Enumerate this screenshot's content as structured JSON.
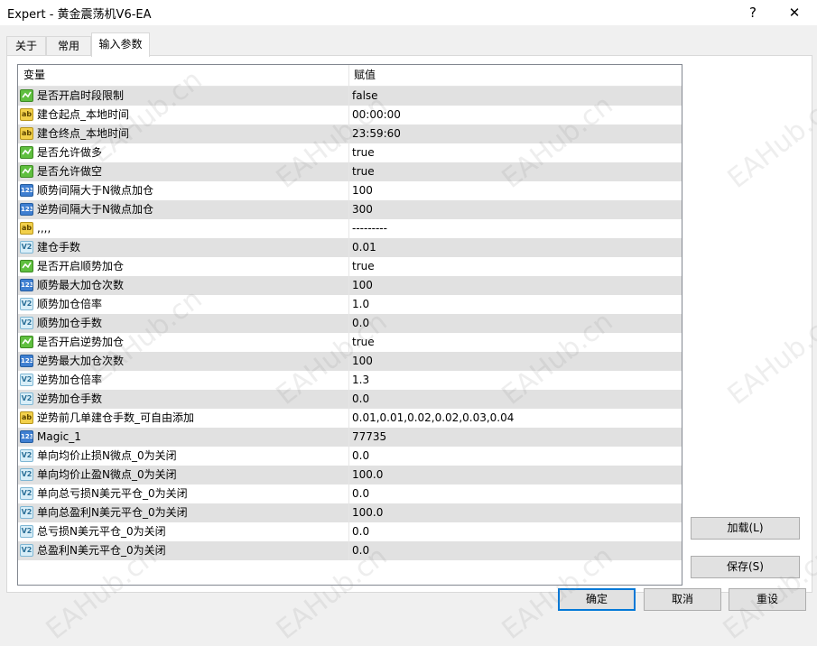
{
  "window": {
    "title": "Expert - 黄金震荡机V6-EA",
    "help_label": "?",
    "close_label": "✕"
  },
  "tabs": [
    {
      "label": "关于"
    },
    {
      "label": "常用"
    },
    {
      "label": "输入参数"
    }
  ],
  "grid": {
    "columns": {
      "variable": "变量",
      "value": "赋值"
    },
    "rows": [
      {
        "icon": "bool",
        "name": "是否开启时段限制",
        "value": "false"
      },
      {
        "icon": "str",
        "name": "建仓起点_本地时间",
        "value": "00:00:00"
      },
      {
        "icon": "str",
        "name": "建仓终点_本地时间",
        "value": "23:59:60"
      },
      {
        "icon": "bool",
        "name": "是否允许做多",
        "value": "true"
      },
      {
        "icon": "bool",
        "name": "是否允许做空",
        "value": "true"
      },
      {
        "icon": "int",
        "name": "顺势间隔大于N微点加仓",
        "value": "100"
      },
      {
        "icon": "int",
        "name": "逆势间隔大于N微点加仓",
        "value": "300"
      },
      {
        "icon": "str",
        "name": ",,,,",
        "value": "---------"
      },
      {
        "icon": "dbl",
        "name": "建仓手数",
        "value": "0.01"
      },
      {
        "icon": "bool",
        "name": "是否开启顺势加仓",
        "value": "true"
      },
      {
        "icon": "int",
        "name": "顺势最大加仓次数",
        "value": "100"
      },
      {
        "icon": "dbl",
        "name": "顺势加仓倍率",
        "value": "1.0"
      },
      {
        "icon": "dbl",
        "name": "顺势加仓手数",
        "value": "0.0"
      },
      {
        "icon": "bool",
        "name": "是否开启逆势加仓",
        "value": "true"
      },
      {
        "icon": "int",
        "name": "逆势最大加仓次数",
        "value": "100"
      },
      {
        "icon": "dbl",
        "name": "逆势加仓倍率",
        "value": "1.3"
      },
      {
        "icon": "dbl",
        "name": "逆势加仓手数",
        "value": "0.0"
      },
      {
        "icon": "str",
        "name": "逆势前几单建仓手数_可自由添加",
        "value": "0.01,0.01,0.02,0.02,0.03,0.04"
      },
      {
        "icon": "int",
        "name": "Magic_1",
        "value": "77735"
      },
      {
        "icon": "dbl",
        "name": "单向均价止损N微点_0为关闭",
        "value": "0.0"
      },
      {
        "icon": "dbl",
        "name": "单向均价止盈N微点_0为关闭",
        "value": "100.0"
      },
      {
        "icon": "dbl",
        "name": "单向总亏损N美元平仓_0为关闭",
        "value": "0.0"
      },
      {
        "icon": "dbl",
        "name": "单向总盈利N美元平仓_0为关闭",
        "value": "100.0"
      },
      {
        "icon": "dbl",
        "name": "总亏损N美元平仓_0为关闭",
        "value": "0.0"
      },
      {
        "icon": "dbl",
        "name": "总盈利N美元平仓_0为关闭",
        "value": "0.0"
      }
    ]
  },
  "icon_glyphs": {
    "str": "ab",
    "int": "123",
    "dbl": "V2"
  },
  "buttons": {
    "load": "加载(L)",
    "save": "保存(S)",
    "ok": "确定",
    "cancel": "取消",
    "reset": "重设"
  },
  "watermark": "EAHub.cn",
  "colors": {
    "accent": "#0078d7",
    "row_alt": "#e1e1e1",
    "bool_icon": "#5fbf3f",
    "str_icon": "#f2d04a",
    "int_icon": "#3f7fd1"
  }
}
